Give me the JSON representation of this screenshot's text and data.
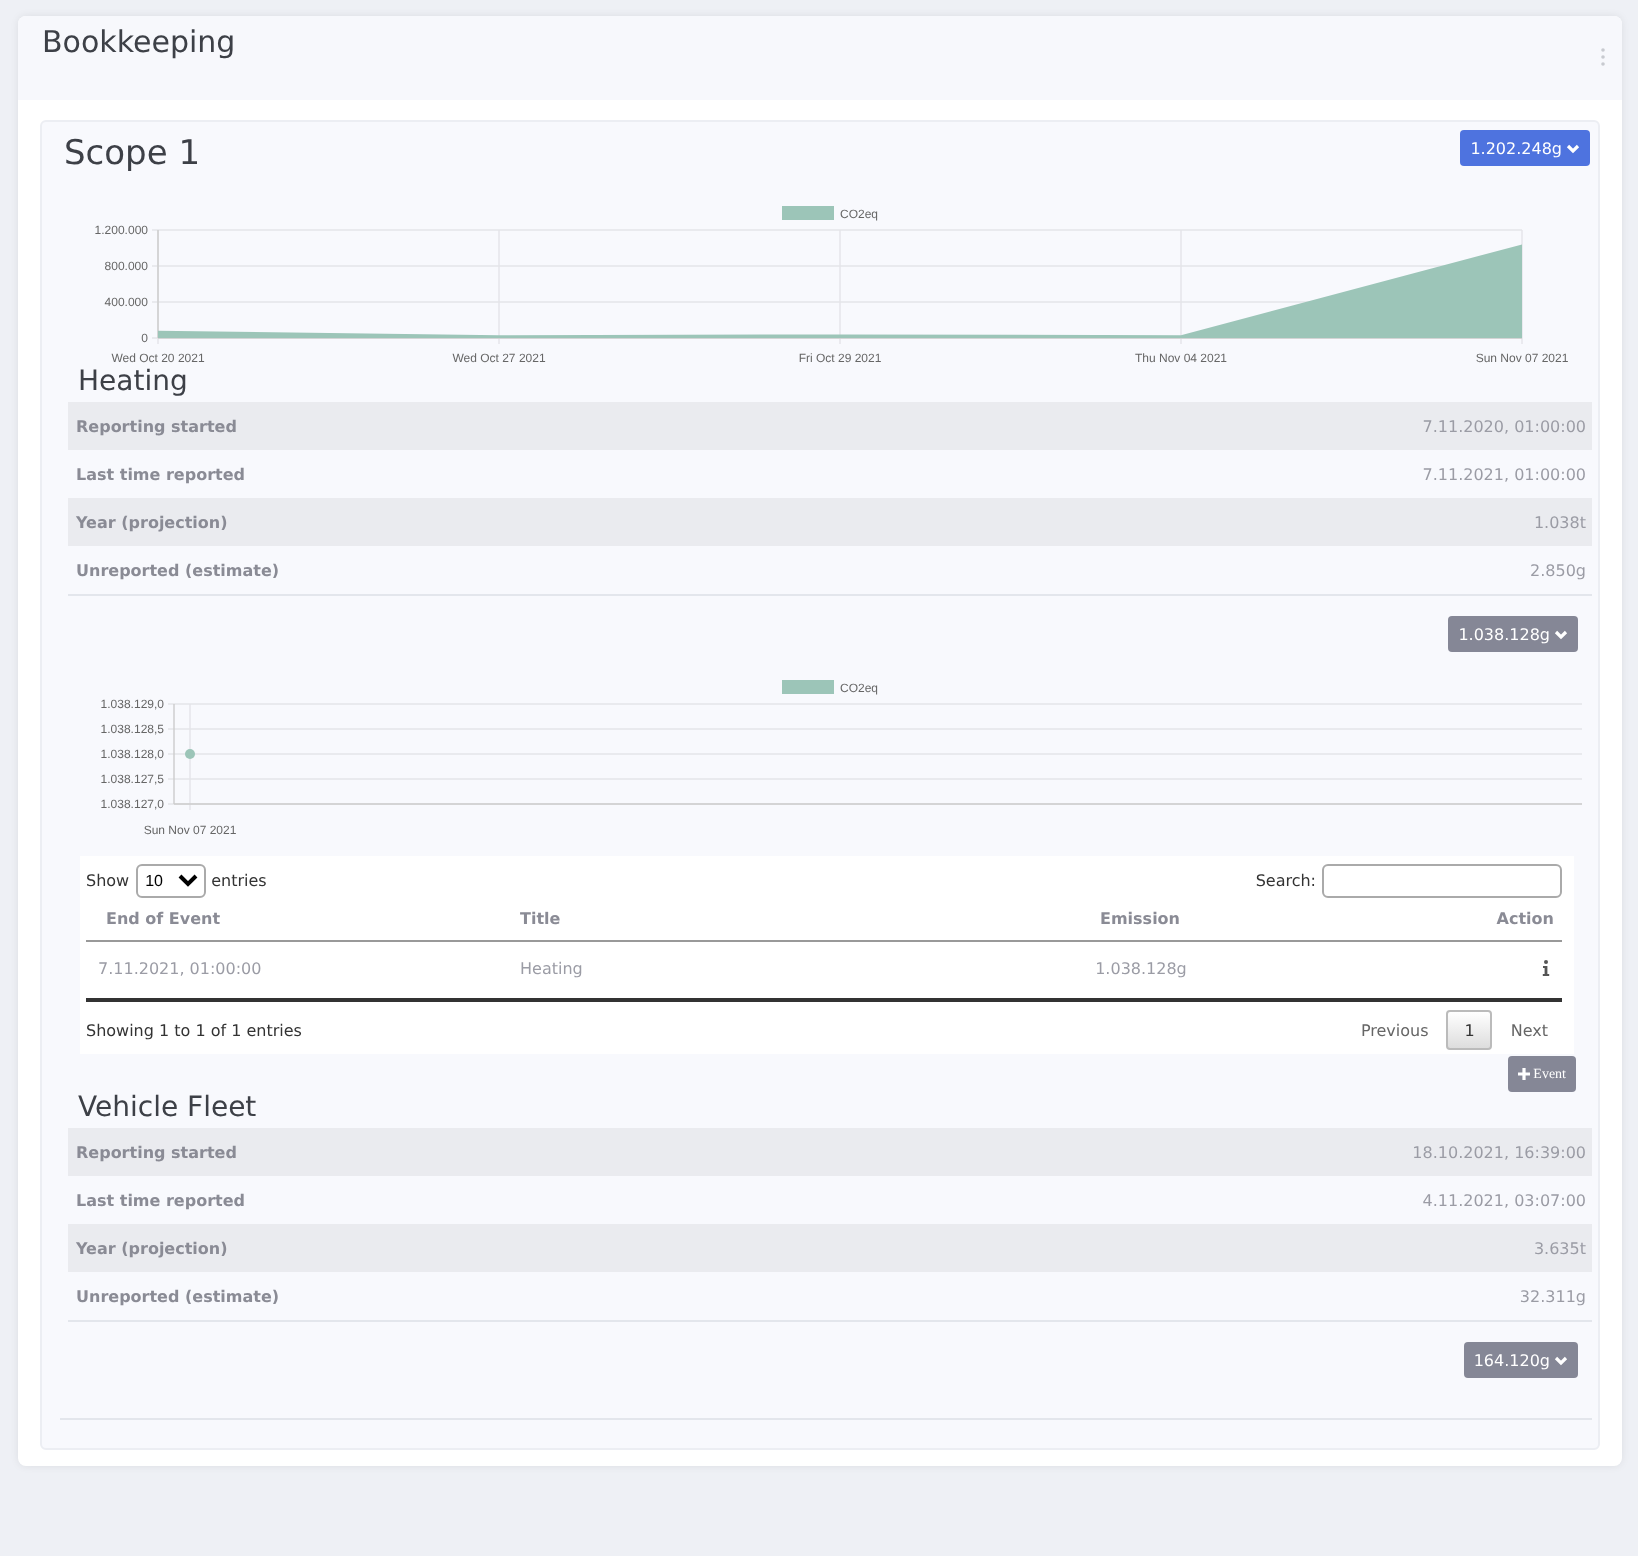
{
  "page": {
    "title": "Bookkeeping"
  },
  "scope": {
    "title": "Scope 1",
    "total_button": "1.202.248g",
    "chart_data": {
      "type": "area",
      "grid": true,
      "categories": [
        "Wed Oct 20 2021",
        "Wed Oct 27 2021",
        "Fri Oct 29 2021",
        "Thu Nov 04 2021",
        "Sun Nov 07 2021"
      ],
      "series": [
        {
          "name": "CO2eq",
          "color": "#9cc5b8",
          "values": [
            80000,
            30000,
            40000,
            30000,
            1040000
          ]
        }
      ],
      "ylim": [
        0,
        1200000
      ],
      "yticks": [
        {
          "value": 0,
          "label": "0"
        },
        {
          "value": 400000,
          "label": "400.000"
        },
        {
          "value": 800000,
          "label": "800.000"
        },
        {
          "value": 1200000,
          "label": "1.200.000"
        }
      ]
    }
  },
  "sections": [
    {
      "title": "Heating",
      "stats": [
        {
          "label": "Reporting started",
          "value": "7.11.2020, 01:00:00"
        },
        {
          "label": "Last time reported",
          "value": "7.11.2021, 01:00:00"
        },
        {
          "label": "Year (projection)",
          "value": "1.038t"
        },
        {
          "label": "Unreported (estimate)",
          "value": "2.850g"
        }
      ],
      "total_button": "1.038.128g",
      "chart_data": {
        "type": "line",
        "grid": true,
        "categories": [
          "Sun Nov 07 2021"
        ],
        "series": [
          {
            "name": "CO2eq",
            "color": "#9cc5b8",
            "marker": "circle",
            "values": [
              1038128
            ]
          }
        ],
        "ylim": [
          1038127,
          1038129
        ],
        "yticks": [
          {
            "value": 1038127,
            "label": "1.038.127,0"
          },
          {
            "value": 1038127.5,
            "label": "1.038.127,5"
          },
          {
            "value": 1038128,
            "label": "1.038.128,0"
          },
          {
            "value": 1038128.5,
            "label": "1.038.128,5"
          },
          {
            "value": 1038129,
            "label": "1.038.129,0"
          }
        ]
      },
      "events": {
        "show_label": "Show",
        "length": "10",
        "entries_label": "entries",
        "search_label": "Search:",
        "columns": [
          "End of Event",
          "Title",
          "Emission",
          "Action"
        ],
        "rows": [
          {
            "end": "7.11.2021, 01:00:00",
            "title": "Heating",
            "emission": "1.038.128g"
          }
        ],
        "info": "Showing 1 to 1 of 1 entries",
        "pagination": [
          {
            "label": "Previous",
            "kind": "prev",
            "selected": false
          },
          {
            "label": "1",
            "kind": "page",
            "selected": true
          },
          {
            "label": "Next",
            "kind": "next",
            "selected": false
          }
        ],
        "add_button": "Event"
      }
    },
    {
      "title": "Vehicle Fleet",
      "stats": [
        {
          "label": "Reporting started",
          "value": "18.10.2021, 16:39:00"
        },
        {
          "label": "Last time reported",
          "value": "4.11.2021, 03:07:00"
        },
        {
          "label": "Year (projection)",
          "value": "3.635t"
        },
        {
          "label": "Unreported (estimate)",
          "value": "32.311g"
        }
      ],
      "total_button": "164.120g"
    }
  ]
}
